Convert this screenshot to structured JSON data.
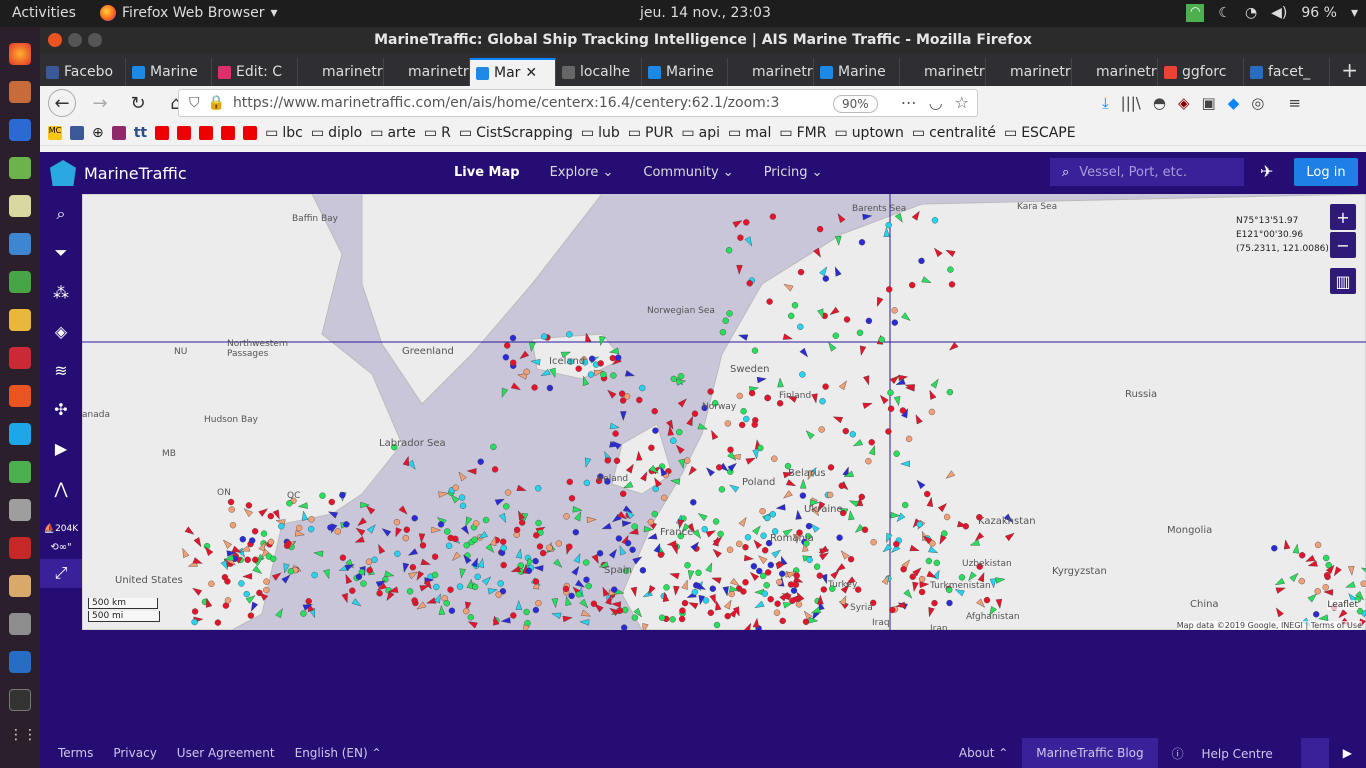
{
  "system": {
    "activities": "Activities",
    "app_name": "Firefox Web Browser",
    "clock": "jeu. 14 nov., 23:03",
    "battery": "96 %"
  },
  "window": {
    "title": "MarineTraffic: Global Ship Tracking Intelligence | AIS Marine Traffic - Mozilla Firefox"
  },
  "tabs": [
    {
      "label": "Facebo",
      "color": "#3b5998"
    },
    {
      "label": "Marine",
      "color": "#1e88e5"
    },
    {
      "label": "Edit: C",
      "color": "#e0306b"
    },
    {
      "label": "marinetra",
      "color": ""
    },
    {
      "label": "marinetra",
      "color": ""
    },
    {
      "label": "Mar",
      "color": "#1e88e5"
    },
    {
      "label": "localhe",
      "color": "#666"
    },
    {
      "label": "Marine",
      "color": "#1e88e5"
    },
    {
      "label": "marinetra",
      "color": ""
    },
    {
      "label": "Marine",
      "color": "#1e88e5"
    },
    {
      "label": "marinetra",
      "color": ""
    },
    {
      "label": "marinetra",
      "color": ""
    },
    {
      "label": "marinetra",
      "color": ""
    },
    {
      "label": "ggforc",
      "color": "#ea4335"
    },
    {
      "label": "facet_",
      "color": "#276dc3"
    }
  ],
  "nav": {
    "url": "https://www.marinetraffic.com/en/ais/home/centerx:16.4/centery:62.1/zoom:3",
    "zoom": "90%"
  },
  "bookmarks": [
    "lbc",
    "diplo",
    "arte",
    "R",
    "CistScrapping",
    "lub",
    "PUR",
    "api",
    "mal",
    "FMR",
    "uptown",
    "centralité",
    "ESCAPE"
  ],
  "bookmark_prefix": [
    "MC",
    "tt"
  ],
  "mt": {
    "logo": "MarineTraffic",
    "menu": [
      "Live Map",
      "Explore",
      "Community",
      "Pricing"
    ],
    "search_placeholder": "Vessel, Port, etc.",
    "login": "Log in",
    "side_count": "204K",
    "side_time": "∞\""
  },
  "map": {
    "labels": [
      {
        "t": "Baffin Bay"
      },
      {
        "t": "Barents Sea"
      },
      {
        "t": "Kara Sea"
      },
      {
        "t": "Norwegian Sea"
      },
      {
        "t": "Northwestern Passages"
      },
      {
        "t": "Greenland"
      },
      {
        "t": "Iceland"
      },
      {
        "t": "Sweden"
      },
      {
        "t": "Finland"
      },
      {
        "t": "Norway"
      },
      {
        "t": "Russia"
      },
      {
        "t": "Hudson Bay"
      },
      {
        "t": "Labrador Sea"
      },
      {
        "t": "Belarus"
      },
      {
        "t": "Poland"
      },
      {
        "t": "Ireland"
      },
      {
        "t": "Ukraine"
      },
      {
        "t": "Kazakhstan"
      },
      {
        "t": "Mongolia"
      },
      {
        "t": "France"
      },
      {
        "t": "Romania"
      },
      {
        "t": "Uzbekistan"
      },
      {
        "t": "Kyrgyzstan"
      },
      {
        "t": "Spain"
      },
      {
        "t": "Turkey"
      },
      {
        "t": "Turkmenistan"
      },
      {
        "t": "United States"
      },
      {
        "t": "Syria"
      },
      {
        "t": "Afghanistan"
      },
      {
        "t": "China"
      },
      {
        "t": "Iraq"
      },
      {
        "t": "Iran"
      },
      {
        "t": "NU"
      },
      {
        "t": "MB"
      },
      {
        "t": "ON"
      },
      {
        "t": "QC"
      },
      {
        "t": "anada"
      }
    ],
    "coord_lat": "N75°13'51.97",
    "coord_lon": "E121°00'30.96",
    "coord_dec": "(75.2311, 121.0086)",
    "scale_km": "500 km",
    "scale_mi": "500 mi",
    "attribution": "Map data ©2019 Google, INEGI | Terms of Use",
    "leaflet": "Leaflet"
  },
  "footer": {
    "links": [
      "Terms",
      "Privacy",
      "User Agreement",
      "English (EN) ⌃"
    ],
    "about": "About ⌃",
    "blog": "MarineTraffic Blog",
    "help": "Help Centre"
  }
}
